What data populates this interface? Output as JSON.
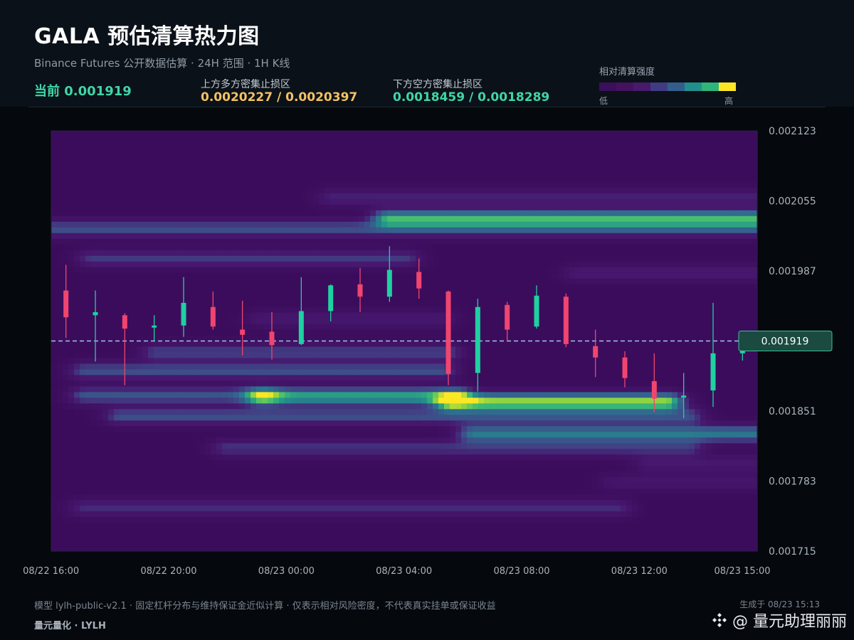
{
  "header": {
    "title": "GALA 预估清算热力图",
    "subtitle": "Binance Futures 公开数据估算 · 24H 范围 · 1H K线",
    "current": "当前 0.001919",
    "upper_label": "上方多方密集止损区",
    "upper_value": "0.0020227 / 0.0020397",
    "lower_label": "下方空方密集止损区",
    "lower_value": "0.0018459 / 0.0018289",
    "legend_title": "相对清算强度",
    "legend_low": "低",
    "legend_high": "高"
  },
  "colors": {
    "bull": "#1fd1a1",
    "bear": "#f0456f",
    "upper_zone": "#f4c163",
    "lower_zone": "#3fd6a8",
    "legend": [
      "#3b0f5c",
      "#44125f",
      "#481a6c",
      "#3f3c84",
      "#335e8c",
      "#21908c",
      "#2fb47c",
      "#fde725"
    ]
  },
  "chart_data": {
    "type": "heatmap",
    "overlay": "candlestick",
    "ylim": [
      0.001715,
      0.002123
    ],
    "y_ticks": [
      "0.002123",
      "0.002055",
      "0.001987",
      "0.001919",
      "0.001851",
      "0.001783",
      "0.001715"
    ],
    "x_ticks": [
      "08/22 16:00",
      "08/22 20:00",
      "08/23 00:00",
      "08/23 04:00",
      "08/23 08:00",
      "08/23 12:00",
      "08/23 15:00"
    ],
    "current_price": 0.001919,
    "current_price_label": "0.001919",
    "candles": [
      {
        "o": 0.001968,
        "h": 0.001993,
        "l": 0.001922,
        "c": 0.001942
      },
      {
        "o": 0.001944,
        "h": 0.001968,
        "l": 0.001899,
        "c": 0.001947
      },
      {
        "o": 0.001944,
        "h": 0.001946,
        "l": 0.001876,
        "c": 0.001931
      },
      {
        "o": 0.001932,
        "h": 0.001944,
        "l": 0.001919,
        "c": 0.001934
      },
      {
        "o": 0.001934,
        "h": 0.001981,
        "l": 0.001923,
        "c": 0.001956
      },
      {
        "o": 0.001952,
        "h": 0.001967,
        "l": 0.00193,
        "c": 0.001933
      },
      {
        "o": 0.00193,
        "h": 0.001958,
        "l": 0.001905,
        "c": 0.001925
      },
      {
        "o": 0.001928,
        "h": 0.001947,
        "l": 0.001901,
        "c": 0.001915
      },
      {
        "o": 0.001916,
        "h": 0.001981,
        "l": 0.001915,
        "c": 0.001948
      },
      {
        "o": 0.001948,
        "h": 0.001974,
        "l": 0.001938,
        "c": 0.001973
      },
      {
        "o": 0.001974,
        "h": 0.00199,
        "l": 0.001947,
        "c": 0.001962
      },
      {
        "o": 0.001962,
        "h": 0.002011,
        "l": 0.001957,
        "c": 0.001988
      },
      {
        "o": 0.001986,
        "h": 0.001999,
        "l": 0.00196,
        "c": 0.00197
      },
      {
        "o": 0.001967,
        "h": 0.001968,
        "l": 0.001876,
        "c": 0.001887
      },
      {
        "o": 0.001888,
        "h": 0.00196,
        "l": 0.00187,
        "c": 0.001952
      },
      {
        "o": 0.001954,
        "h": 0.001957,
        "l": 0.001919,
        "c": 0.00193
      },
      {
        "o": 0.001933,
        "h": 0.001973,
        "l": 0.001931,
        "c": 0.001963
      },
      {
        "o": 0.001962,
        "h": 0.001965,
        "l": 0.001913,
        "c": 0.001916
      },
      {
        "o": 0.001914,
        "h": 0.00193,
        "l": 0.001884,
        "c": 0.001903
      },
      {
        "o": 0.001903,
        "h": 0.001909,
        "l": 0.001874,
        "c": 0.001883
      },
      {
        "o": 0.00188,
        "h": 0.001907,
        "l": 0.00185,
        "c": 0.001863
      },
      {
        "o": 0.001864,
        "h": 0.001888,
        "l": 0.001844,
        "c": 0.001866
      },
      {
        "o": 0.001871,
        "h": 0.001956,
        "l": 0.001855,
        "c": 0.001907
      },
      {
        "o": 0.001907,
        "h": 0.00192,
        "l": 0.0019,
        "c": 0.001919
      }
    ],
    "liquidation_bands": [
      {
        "price": 0.002038,
        "strength": 0.72,
        "from": 0.48,
        "to": 1.0
      },
      {
        "price": 0.002028,
        "strength": 0.38,
        "from": 0.0,
        "to": 1.0
      },
      {
        "price": 0.002058,
        "strength": 0.22,
        "from": 0.4,
        "to": 1.0
      },
      {
        "price": 0.001999,
        "strength": 0.3,
        "from": 0.06,
        "to": 0.5
      },
      {
        "price": 0.001985,
        "strength": 0.2,
        "from": 0.75,
        "to": 1.0
      },
      {
        "price": 0.00194,
        "strength": 0.18,
        "from": 0.3,
        "to": 0.55
      },
      {
        "price": 0.001908,
        "strength": 0.32,
        "from": 0.15,
        "to": 0.56
      },
      {
        "price": 0.00189,
        "strength": 0.38,
        "from": 0.05,
        "to": 0.55
      },
      {
        "price": 0.001865,
        "strength": 0.72,
        "from": 0.3,
        "to": 0.57
      },
      {
        "price": 0.00186,
        "strength": 0.92,
        "from": 0.57,
        "to": 0.87
      },
      {
        "price": 0.001866,
        "strength": 0.4,
        "from": 0.05,
        "to": 0.3
      },
      {
        "price": 0.001846,
        "strength": 0.38,
        "from": 0.1,
        "to": 0.9
      },
      {
        "price": 0.001829,
        "strength": 0.55,
        "from": 0.6,
        "to": 1.0
      },
      {
        "price": 0.001815,
        "strength": 0.28,
        "from": 0.25,
        "to": 0.9
      },
      {
        "price": 0.0018,
        "strength": 0.18,
        "from": 0.85,
        "to": 1.0
      },
      {
        "price": 0.001757,
        "strength": 0.25,
        "from": 0.05,
        "to": 0.8
      },
      {
        "price": 0.001782,
        "strength": 0.15,
        "from": 0.8,
        "to": 1.0
      }
    ]
  },
  "footer": {
    "note": "模型 lylh-public-v2.1 · 固定杠杆分布与维持保证金近似计算 · 仅表示相对风险密度，不代表真实挂单或保证收益",
    "brand": "量元量化 · LYLH",
    "generated": "生成于 08/23 15:13",
    "watermark": "@ 量元助理丽丽",
    "watermark_icon": "binance-diamond-icon"
  }
}
